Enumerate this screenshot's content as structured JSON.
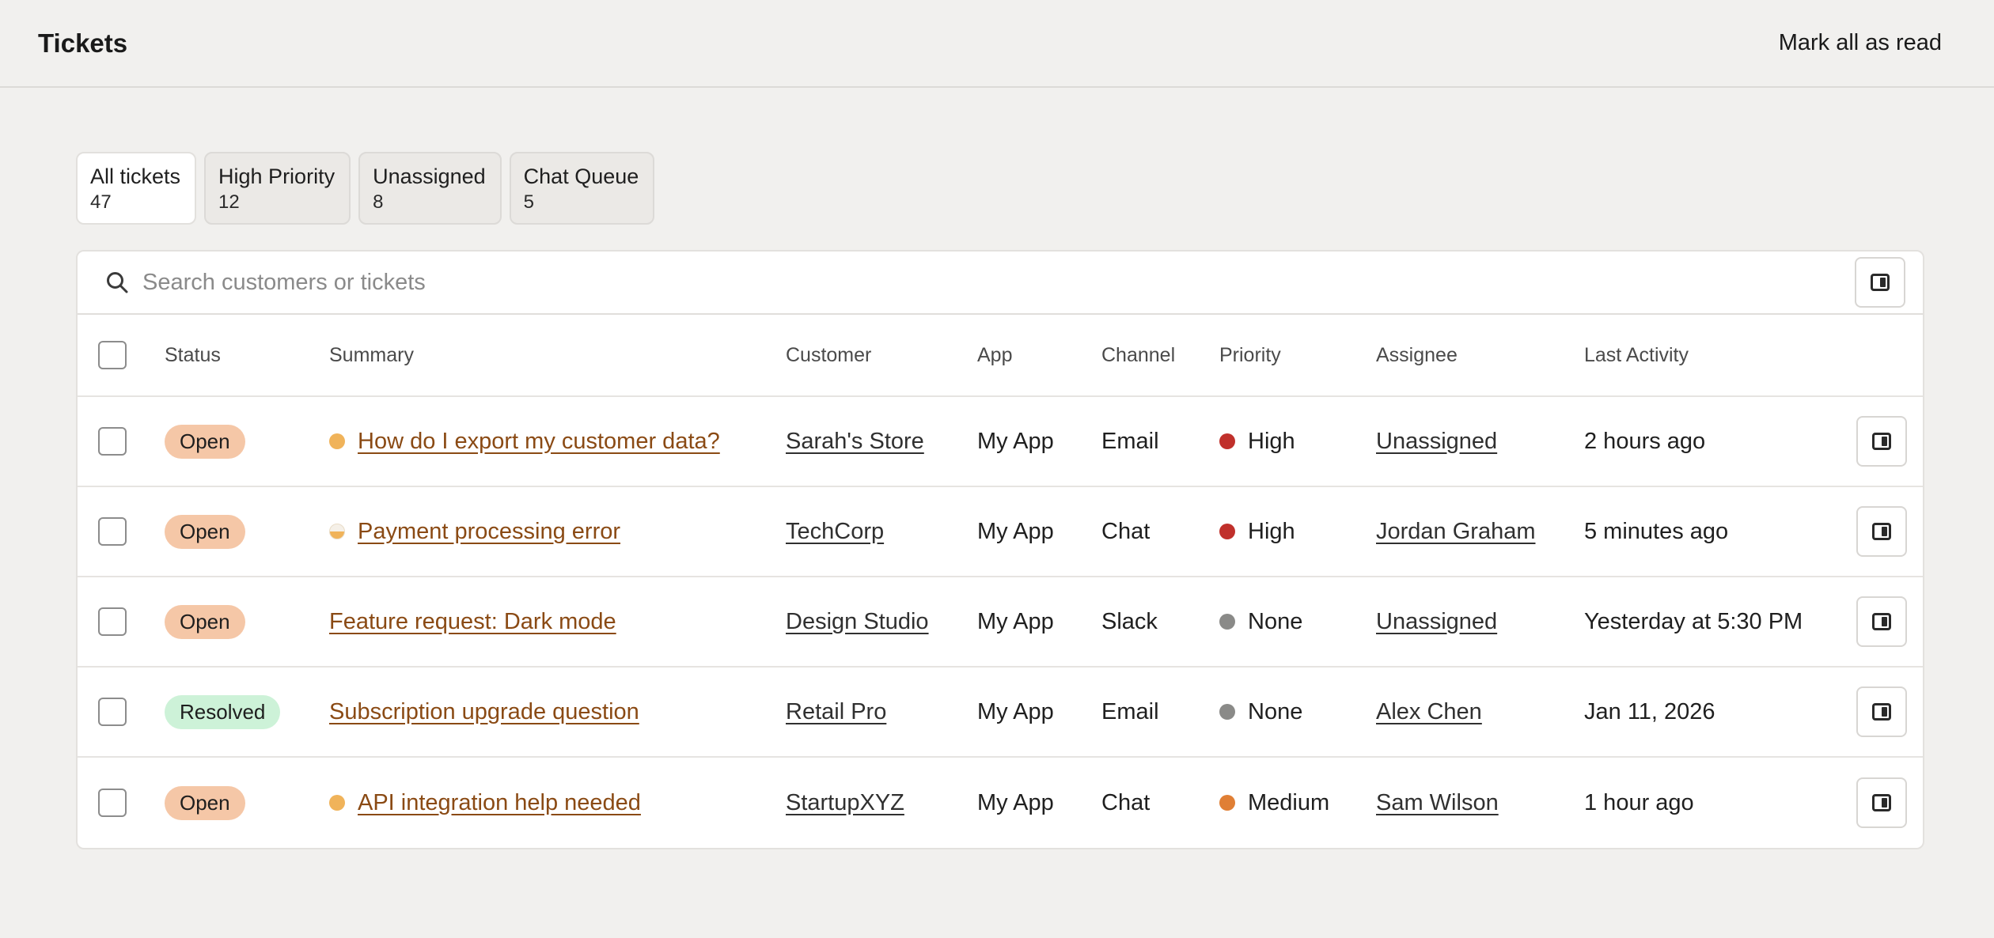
{
  "header": {
    "title": "Tickets",
    "mark_all_label": "Mark all as read"
  },
  "tabs": [
    {
      "label": "All tickets",
      "count": "47",
      "active": true
    },
    {
      "label": "High Priority",
      "count": "12",
      "active": false
    },
    {
      "label": "Unassigned",
      "count": "8",
      "active": false
    },
    {
      "label": "Chat Queue",
      "count": "5",
      "active": false
    }
  ],
  "search": {
    "placeholder": "Search customers or tickets",
    "icon": "search-icon"
  },
  "columns": {
    "status": "Status",
    "summary": "Summary",
    "customer": "Customer",
    "app": "App",
    "channel": "Channel",
    "priority": "Priority",
    "assignee": "Assignee",
    "last_activity": "Last Activity"
  },
  "colors": {
    "accent_link": "#8a4a14",
    "open_badge": "#f5c7a7",
    "resolved_badge": "#cdf2d8",
    "priority_high": "#c0302b",
    "priority_none": "#8a8a88",
    "priority_medium": "#e07f35",
    "unread_dot": "#f0b35a"
  },
  "tickets": [
    {
      "status": "Open",
      "status_kind": "open",
      "unread": "full",
      "summary": "How do I export my customer data?",
      "customer": "Sarah's Store",
      "app": "My App",
      "channel": "Email",
      "priority": "High",
      "priority_color": "#c0302b",
      "assignee": "Unassigned",
      "last_activity": "2 hours ago"
    },
    {
      "status": "Open",
      "status_kind": "open",
      "unread": "half",
      "summary": "Payment processing error",
      "customer": "TechCorp",
      "app": "My App",
      "channel": "Chat",
      "priority": "High",
      "priority_color": "#c0302b",
      "assignee": "Jordan Graham",
      "last_activity": "5 minutes ago"
    },
    {
      "status": "Open",
      "status_kind": "open",
      "unread": "none",
      "summary": "Feature request: Dark mode",
      "customer": "Design Studio",
      "app": "My App",
      "channel": "Slack",
      "priority": "None",
      "priority_color": "#8a8a88",
      "assignee": "Unassigned",
      "last_activity": "Yesterday at 5:30 PM"
    },
    {
      "status": "Resolved",
      "status_kind": "resolved",
      "unread": "none",
      "summary": "Subscription upgrade question",
      "customer": "Retail Pro",
      "app": "My App",
      "channel": "Email",
      "priority": "None",
      "priority_color": "#8a8a88",
      "assignee": "Alex Chen",
      "last_activity": "Jan 11, 2026"
    },
    {
      "status": "Open",
      "status_kind": "open",
      "unread": "full",
      "summary": "API integration help needed",
      "customer": "StartupXYZ",
      "app": "My App",
      "channel": "Chat",
      "priority": "Medium",
      "priority_color": "#e07f35",
      "assignee": "Sam Wilson",
      "last_activity": "1 hour ago"
    }
  ]
}
